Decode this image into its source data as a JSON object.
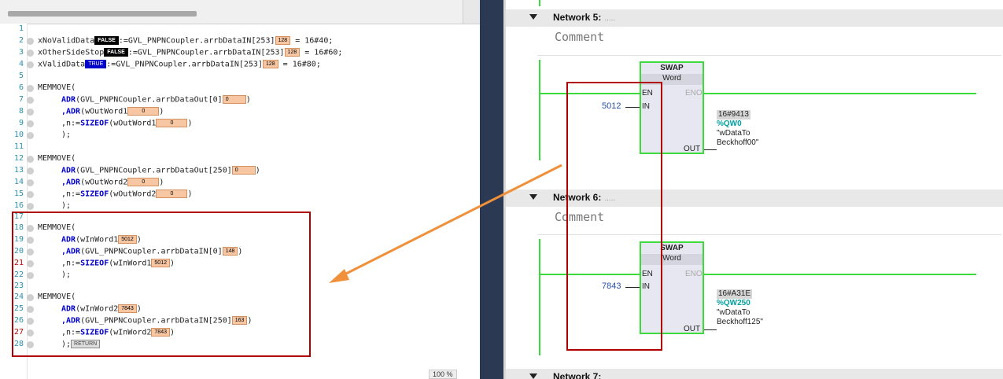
{
  "editor": {
    "line_numbers": [
      "1",
      "2",
      "3",
      "4",
      "5",
      "6",
      "7",
      "8",
      "9",
      "10",
      "11",
      "12",
      "13",
      "14",
      "15",
      "16",
      "17",
      "18",
      "19",
      "20",
      "21",
      "22",
      "23",
      "24",
      "25",
      "26",
      "27",
      "28"
    ],
    "zoom": "100 %",
    "lines": {
      "l2a": "xNoValidData",
      "l2b": ":=GVL_PNPNCoupler.arrbDataIN[253]",
      "l2c": " = 16#40;",
      "l3a": "xOtherSideStop",
      "l3b": ":=GVL_PNPNCoupler.arrbDataIN[253]",
      "l3c": " = 16#60;",
      "l4a": "xValidData",
      "l4b": ":=GVL_PNPNCoupler.arrbDataIN[253]",
      "l4c": " = 16#80;",
      "memmove": "MEMMOVE(",
      "adr": "ADR",
      "comma_adr": ",ADR",
      "n_sizeof_pre": ",n:=",
      "sizeof": "SIZEOF",
      "close": ");",
      "l7": "(GVL_PNPNCoupler.arrbDataOut[0]",
      "l8": "(wOutWord1",
      "l9": "(wOutWord1",
      "l13": "(GVL_PNPNCoupler.arrbDataOut[250]",
      "l14": "(wOutWord2",
      "l15": "(wOutWord2",
      "l19": "(wInWord1",
      "l20": "(GVL_PNPNCoupler.arrbDataIN[0]",
      "l21": "(wInWord1",
      "l25": "(wInWord2",
      "l26": "(GVL_PNPNCoupler.arrbDataIN[250]",
      "l27": "(wInWord2",
      "paren": ")"
    },
    "badges": {
      "false": "FALSE",
      "true": "TRUE",
      "v128": "128",
      "v0": "0",
      "v5012": "5012",
      "v148": "148",
      "v7843": "7843",
      "v163": "163",
      "ret": "RETURN"
    }
  },
  "ladder": {
    "network5": {
      "label": "Network 5:",
      "dots": ".....",
      "comment": "Comment",
      "block_name": "SWAP",
      "block_type": "Word",
      "en": "EN",
      "eno": "ENO",
      "in": "IN",
      "out": "OUT",
      "in_value": "5012",
      "out_hex": "16#9413",
      "out_addr": "%QW0",
      "out_tag1": "\"wDataTo",
      "out_tag2": "Beckhoff00\""
    },
    "network6": {
      "label": "Network 6:",
      "dots": ".....",
      "comment": "Comment",
      "block_name": "SWAP",
      "block_type": "Word",
      "en": "EN",
      "eno": "ENO",
      "in": "IN",
      "out": "OUT",
      "in_value": "7843",
      "out_hex": "16#A31E",
      "out_addr": "%QW250",
      "out_tag1": "\"wDataTo",
      "out_tag2": "Beckhoff125\""
    },
    "network7": {
      "label": "Network 7:"
    }
  },
  "colors": {
    "rung": "#3adb3a",
    "highlight": "#b00000",
    "arrow": "#f0903a"
  }
}
